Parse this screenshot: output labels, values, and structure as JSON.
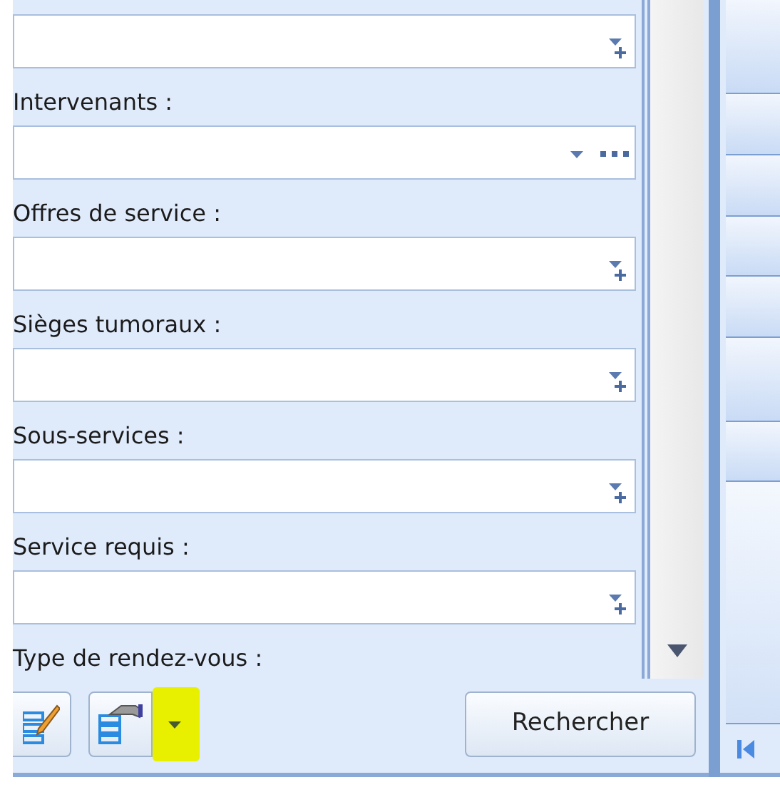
{
  "fields": [
    {
      "kind": "multi"
    },
    {
      "label": "Intervenants :",
      "kind": "lookup"
    },
    {
      "label": "Offres de service :",
      "kind": "multi"
    },
    {
      "label": "Sièges tumoraux :",
      "kind": "multi"
    },
    {
      "label": "Sous-services :",
      "kind": "multi"
    },
    {
      "label": "Service requis :",
      "kind": "multi"
    },
    {
      "label": "Type de rendez-vous :"
    }
  ],
  "toolbar": {
    "split_button": {
      "dropdown_highlighted": true
    },
    "search_button": "Rechercher"
  }
}
